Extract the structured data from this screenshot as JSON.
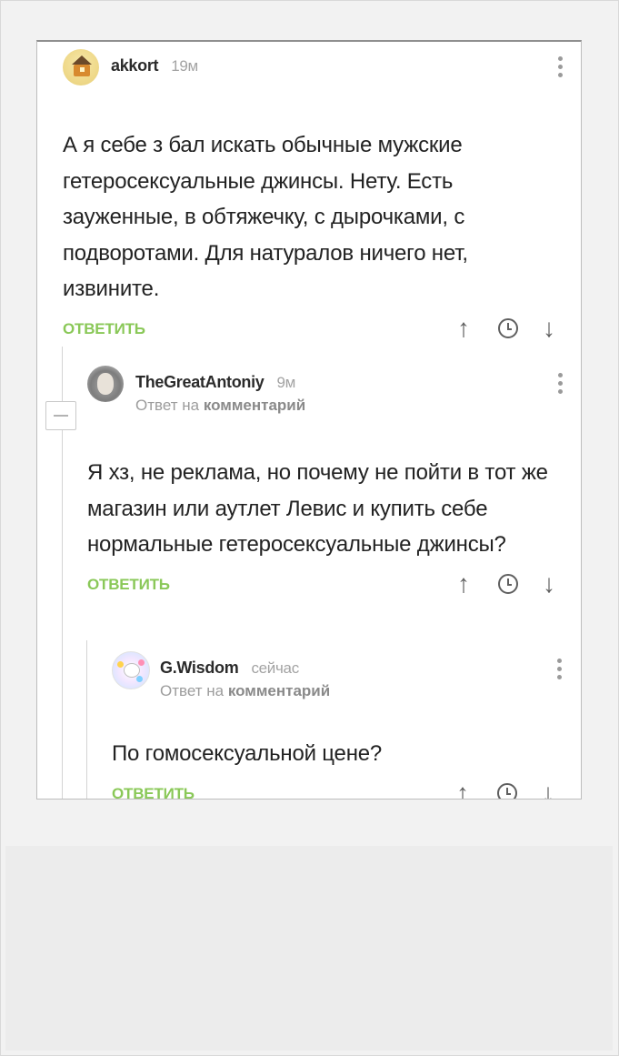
{
  "comments": [
    {
      "author": "akkort",
      "time": "19м",
      "text": "А я себе з бал искать обычные мужские гетеросексуальные джинсы. Нету. Есть зауженные, в обтяжечку, с дырочками, с подворотами. Для натуралов ничего нет, извините.",
      "reply_label": "ОТВЕТИТЬ"
    },
    {
      "author": "TheGreatAntoniy",
      "time": "9м",
      "reply_to_prefix": "Ответ на",
      "reply_to_target": "комментарий",
      "text": "Я хз, не реклама, но почему не пойти в тот же магазин или аутлет Левис и купить себе нормальные гетеросексуальные джинсы?",
      "reply_label": "ОТВЕТИТЬ"
    },
    {
      "author": "G.Wisdom",
      "time": "сейчас",
      "reply_to_prefix": "Ответ на",
      "reply_to_target": "комментарий",
      "text": "По гомосексуальной цене?",
      "reply_label": "ОТВЕТИТЬ"
    }
  ],
  "icons": {
    "vote_up": "↑",
    "history": "clock-icon",
    "vote_down": "↓",
    "more": "more-vertical-icon",
    "collapse": "minus-icon"
  },
  "colors": {
    "reply_green": "#8ac858",
    "text": "#222222",
    "meta": "#a3a3a3"
  }
}
